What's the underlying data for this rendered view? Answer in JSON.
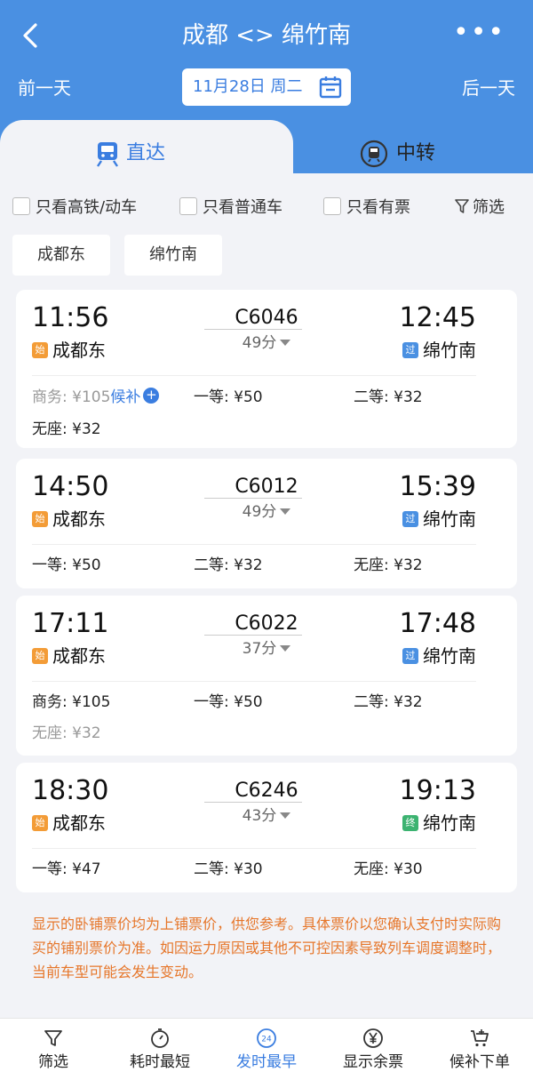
{
  "header": {
    "title": "成都 <> 绵竹南",
    "prev_day": "前一天",
    "next_day": "后一天",
    "date": "11月28日 周二",
    "more": "•••"
  },
  "tabs": [
    {
      "label": "直达",
      "active": true
    },
    {
      "label": "中转",
      "active": false
    }
  ],
  "filters": {
    "high_speed_only": "只看高铁/动车",
    "normal_only": "只看普通车",
    "available_only": "只看有票",
    "filter": "筛选"
  },
  "stations": [
    "成都东",
    "绵竹南"
  ],
  "trains": [
    {
      "dep_time": "11:56",
      "arr_time": "12:45",
      "train_no": "C6046",
      "duration": "49分",
      "dep_tag": "始",
      "dep_station": "成都东",
      "arr_tag": "过",
      "arr_station": "绵竹南",
      "prices": [
        {
          "label": "商务: ¥105",
          "extra": "候补",
          "available": false
        },
        {
          "label": "一等: ¥50",
          "available": true
        },
        {
          "label": "二等: ¥32",
          "available": true
        },
        {
          "label": "无座: ¥32",
          "available": true
        }
      ]
    },
    {
      "dep_time": "14:50",
      "arr_time": "15:39",
      "train_no": "C6012",
      "duration": "49分",
      "dep_tag": "始",
      "dep_station": "成都东",
      "arr_tag": "过",
      "arr_station": "绵竹南",
      "prices": [
        {
          "label": "一等: ¥50",
          "available": true
        },
        {
          "label": "二等: ¥32",
          "available": true
        },
        {
          "label": "无座: ¥32",
          "available": true
        }
      ]
    },
    {
      "dep_time": "17:11",
      "arr_time": "17:48",
      "train_no": "C6022",
      "duration": "37分",
      "dep_tag": "始",
      "dep_station": "成都东",
      "arr_tag": "过",
      "arr_station": "绵竹南",
      "prices": [
        {
          "label": "商务: ¥105",
          "available": true
        },
        {
          "label": "一等: ¥50",
          "available": true
        },
        {
          "label": "二等: ¥32",
          "available": true
        },
        {
          "label": "无座: ¥32",
          "available": false
        }
      ]
    },
    {
      "dep_time": "18:30",
      "arr_time": "19:13",
      "train_no": "C6246",
      "duration": "43分",
      "dep_tag": "始",
      "dep_station": "成都东",
      "arr_tag": "终",
      "arr_station": "绵竹南",
      "prices": [
        {
          "label": "一等: ¥47",
          "available": true
        },
        {
          "label": "二等: ¥30",
          "available": true
        },
        {
          "label": "无座: ¥30",
          "available": true
        }
      ]
    }
  ],
  "notice": "显示的卧铺票价均为上铺票价，供您参考。具体票价以您确认支付时实际购买的铺别票价为准。如因运力原因或其他不可控因素导致列车调度调整时，当前车型可能会发生变动。",
  "bottom_bar": [
    {
      "label": "筛选",
      "icon": "funnel-icon"
    },
    {
      "label": "耗时最短",
      "icon": "timer-icon"
    },
    {
      "label": "发时最早",
      "icon": "clock-24-icon",
      "icon_text": "24",
      "active": true
    },
    {
      "label": "显示余票",
      "icon": "yen-icon"
    },
    {
      "label": "候补下单",
      "icon": "cart-icon"
    }
  ],
  "colors": {
    "primary": "#4a90e2",
    "accent": "#3a7de0",
    "start_tag": "#f39c37",
    "end_tag": "#3cb371",
    "notice": "#e6762a"
  }
}
